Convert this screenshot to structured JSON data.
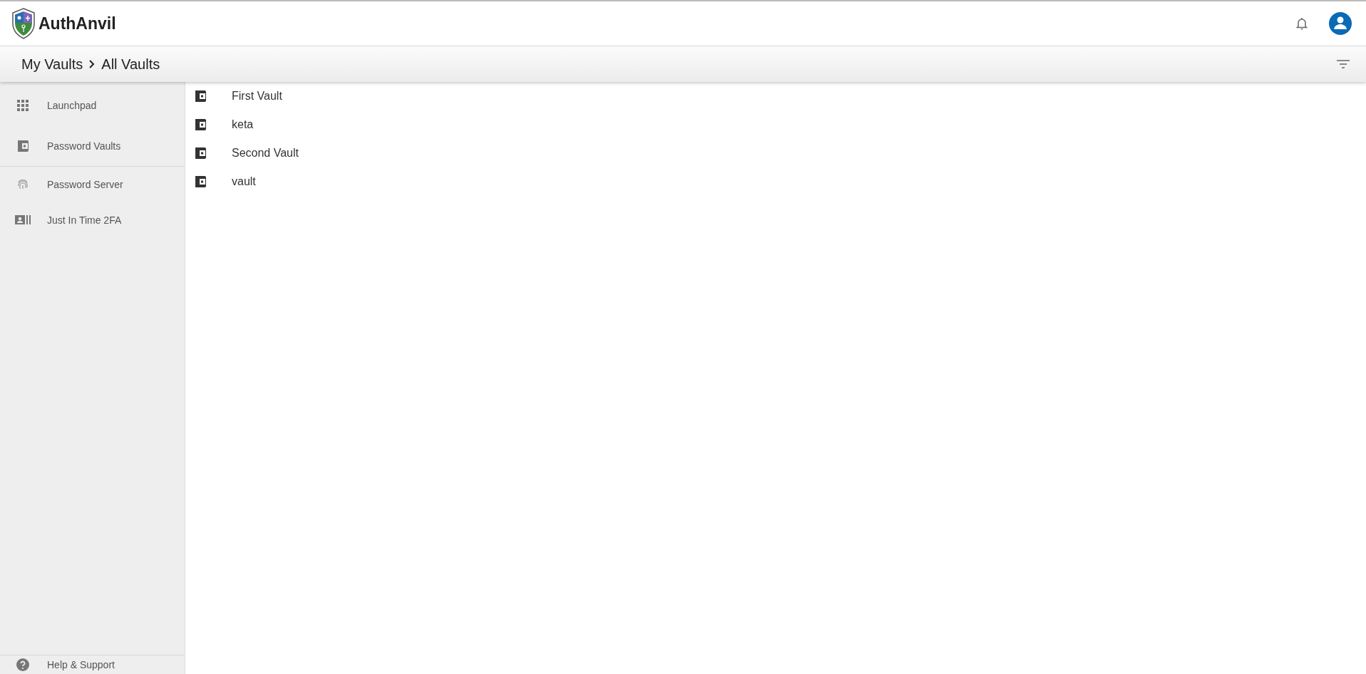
{
  "app": {
    "name": "AuthAnvil"
  },
  "breadcrumb": [
    "My Vaults",
    "All Vaults"
  ],
  "sidebar": {
    "sections": [
      {
        "items": [
          {
            "label": "Launchpad",
            "kind": "grid"
          },
          {
            "label": "Password Vaults",
            "kind": "wallet"
          }
        ]
      },
      {
        "items": [
          {
            "label": "Password Server",
            "kind": "fingerprint"
          },
          {
            "label": "Just In Time 2FA",
            "kind": "card"
          }
        ]
      }
    ],
    "footer": {
      "label": "Help & Support",
      "kind": "help"
    }
  },
  "vaults": [
    {
      "name": "First Vault"
    },
    {
      "name": "keta"
    },
    {
      "name": "Second Vault"
    },
    {
      "name": "vault"
    }
  ]
}
